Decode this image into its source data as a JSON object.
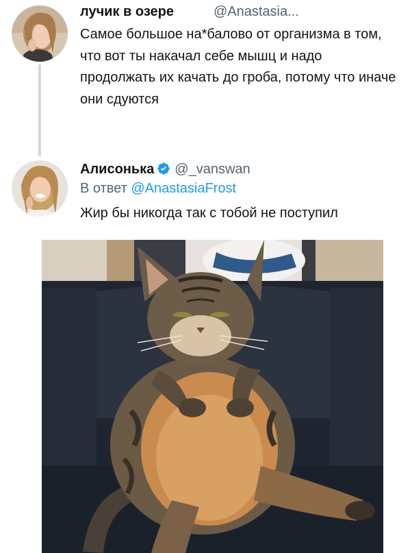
{
  "tweets": [
    {
      "author_name": "лучик в озере",
      "author_handle": "@Anastasia...",
      "text": "Самое большое на*балово от организма в том, что вот ты накачал себе мышц и надо продолжать их качать до гроба, потому что иначе они сдуются"
    },
    {
      "author_name": "Алисонька",
      "author_handle": "@_vanswan",
      "verified": true,
      "reply_prefix": "В ответ",
      "reply_mention": "@AnastasiaFrost",
      "text": "Жир бы никогда так с тобой не поступил"
    }
  ],
  "colors": {
    "text": "#0f1419",
    "secondary": "#536471",
    "link": "#1d9bf0",
    "thread_line": "#cfd9de"
  },
  "icons": {
    "verified": "verified-badge-icon"
  }
}
